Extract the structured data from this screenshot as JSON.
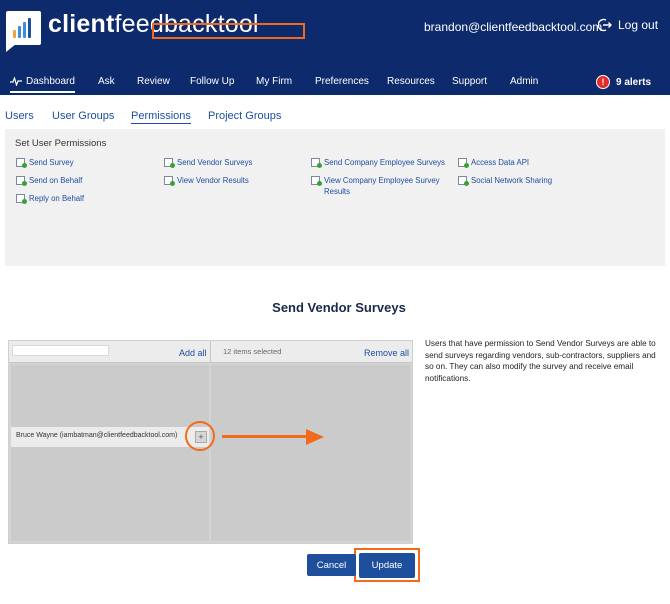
{
  "header": {
    "brand_bold": "client",
    "brand_rest": "feedbacktool",
    "user_email": "brandon@clientfeedbacktool.com",
    "logout_label": "Log out"
  },
  "nav": {
    "items": [
      "Dashboard",
      "Ask",
      "Review",
      "Follow Up",
      "My Firm",
      "Preferences",
      "Resources",
      "Support",
      "Admin"
    ],
    "alerts_icon": "!",
    "alerts_label": "9 alerts"
  },
  "tabs": [
    "Users",
    "User Groups",
    "Permissions",
    "Project Groups"
  ],
  "permissions": {
    "heading": "Set User Permissions",
    "items": [
      "Send Survey",
      "Send on Behalf",
      "Reply on Behalf",
      "Send Vendor Surveys",
      "View Vendor Results",
      "Send Company Employee Surveys",
      "View Company Employee Survey",
      "Results",
      "Access Data API",
      "Social Network Sharing"
    ]
  },
  "section": {
    "title": "Send Vendor Surveys"
  },
  "picker": {
    "add_all": "Add all",
    "items_selected": "12 items selected",
    "remove_all": "Remove all",
    "users": [
      {
        "name": "Bruce Wayne (iambatman@clientfeedbacktool.com)",
        "add_symbol": "+"
      }
    ]
  },
  "description": "Users that have permission to Send Vendor Surveys are able to send surveys regarding vendors, sub-contractors, suppliers and so on. They can also modify the survey and receive email notifications.",
  "actions": {
    "cancel": "Cancel",
    "update": "Update"
  },
  "colors": {
    "header_bg": "#0d2a6c",
    "accent_blue": "#1e4f9c",
    "highlight_orange": "#f26b1d",
    "alert_red": "#e32b2b"
  }
}
